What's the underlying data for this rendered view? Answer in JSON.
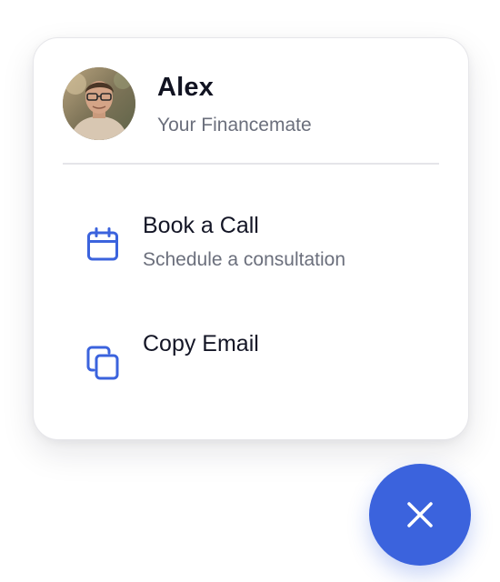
{
  "profile": {
    "name": "Alex",
    "role": "Your Financemate",
    "avatar_icon": "person-photo-icon"
  },
  "menu": {
    "items": [
      {
        "title": "Book a Call",
        "subtitle": "Schedule a consultation",
        "icon": "calendar-icon"
      },
      {
        "title": "Copy Email",
        "icon": "copy-icon"
      }
    ]
  },
  "fab": {
    "icon": "close-icon"
  },
  "colors": {
    "accent": "#3b63dd",
    "text_primary": "#111321",
    "text_secondary": "#6b6f7c",
    "divider": "#e5e5e9"
  }
}
